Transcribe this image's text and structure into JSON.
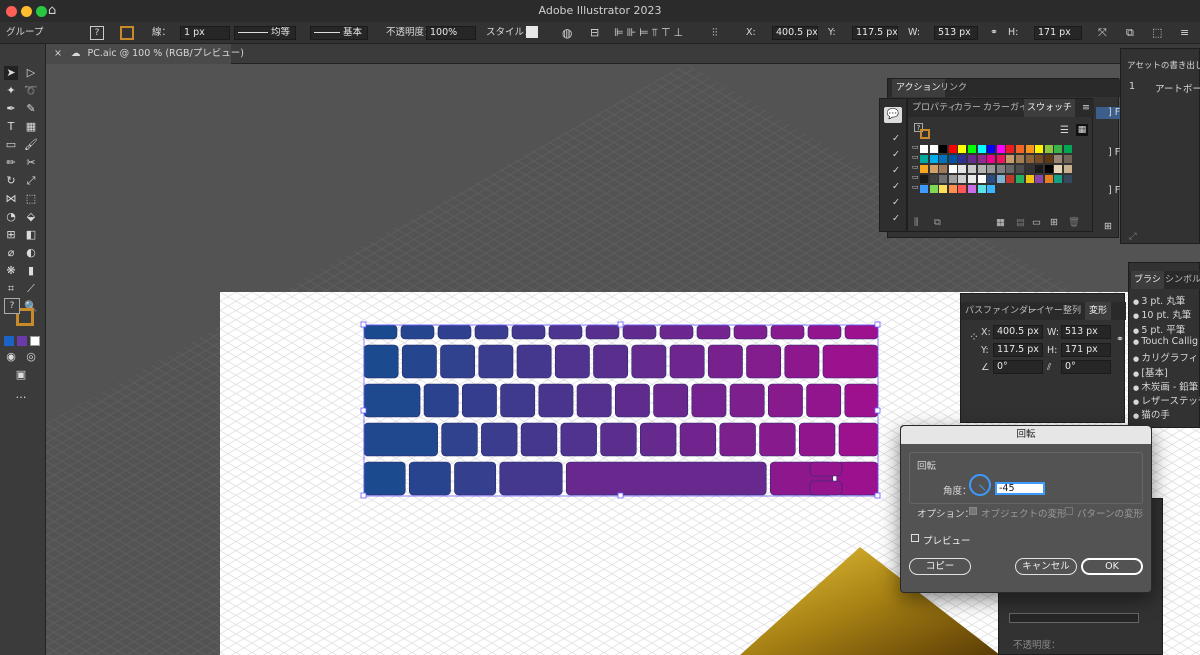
{
  "window": {
    "title": "Adobe Illustrator 2023"
  },
  "control_bar": {
    "selection_label": "グループ",
    "stroke_label": "線：",
    "stroke_value": "1 px",
    "stroke_profile": "均等",
    "brush_label": "基本",
    "opacity_label": "不透明度：",
    "opacity_value": "100%",
    "style_label": "スタイル：",
    "x_label": "X:",
    "x_value": "400.5 px",
    "y_label": "Y:",
    "y_value": "117.5 px",
    "w_label": "W:",
    "w_value": "513 px",
    "h_label": "H:",
    "h_value": "171 px"
  },
  "document_tab": {
    "label": "PC.aic @ 100 % (RGB/プレビュー)"
  },
  "actions_panel": {
    "tabs": [
      "アクション",
      "リンク"
    ],
    "row_prefix": [
      "] F",
      "] F",
      "] F"
    ]
  },
  "swatches_panel": {
    "tabs": [
      "プロパティ",
      "カラー",
      "カラーガイ",
      "スウォッチ"
    ],
    "active": "スウォッチ"
  },
  "asset_export_panel": {
    "title": "アセットの書き出し",
    "row_number": "1",
    "row_label": "アートボー"
  },
  "brushes_panel": {
    "tabs": [
      "ブラシ",
      "シンボル"
    ],
    "items": [
      "3 pt. 丸筆",
      "10 pt. 丸筆",
      "5 pt. 平筆",
      "Touch Callig",
      "カリグラフィ",
      "[基本]",
      "木炭画 - 鉛筆",
      "レザーステッチ",
      "猫の手"
    ]
  },
  "transform_panel": {
    "tabs": [
      "パスファインダー",
      "レイヤー",
      "整列",
      "変形"
    ],
    "active": "変形",
    "x_label": "X:",
    "x_value": "400.5 px",
    "w_label": "W:",
    "w_value": "513 px",
    "y_label": "Y:",
    "y_value": "117.5 px",
    "h_label": "H:",
    "h_value": "171 px",
    "rotate_value": "0°",
    "shear_value": "0°"
  },
  "lower_panel": {
    "opacity_label": "不透明度："
  },
  "rotate_dialog": {
    "title": "回転",
    "section": "回転",
    "angle_label": "角度：",
    "angle_value": "-45",
    "options_label": "オプション：",
    "opt_objects": "オブジェクトの変形",
    "opt_pattern": "パターンの変形",
    "preview_label": "プレビュー",
    "copy_label": "コピー",
    "cancel_label": "キャンセル",
    "ok_label": "OK"
  },
  "colors": {
    "accent_selection": "#6a5cff",
    "key_start": "#1a4a8a",
    "key_end": "#a0108e",
    "gold": "#c9a82a"
  }
}
